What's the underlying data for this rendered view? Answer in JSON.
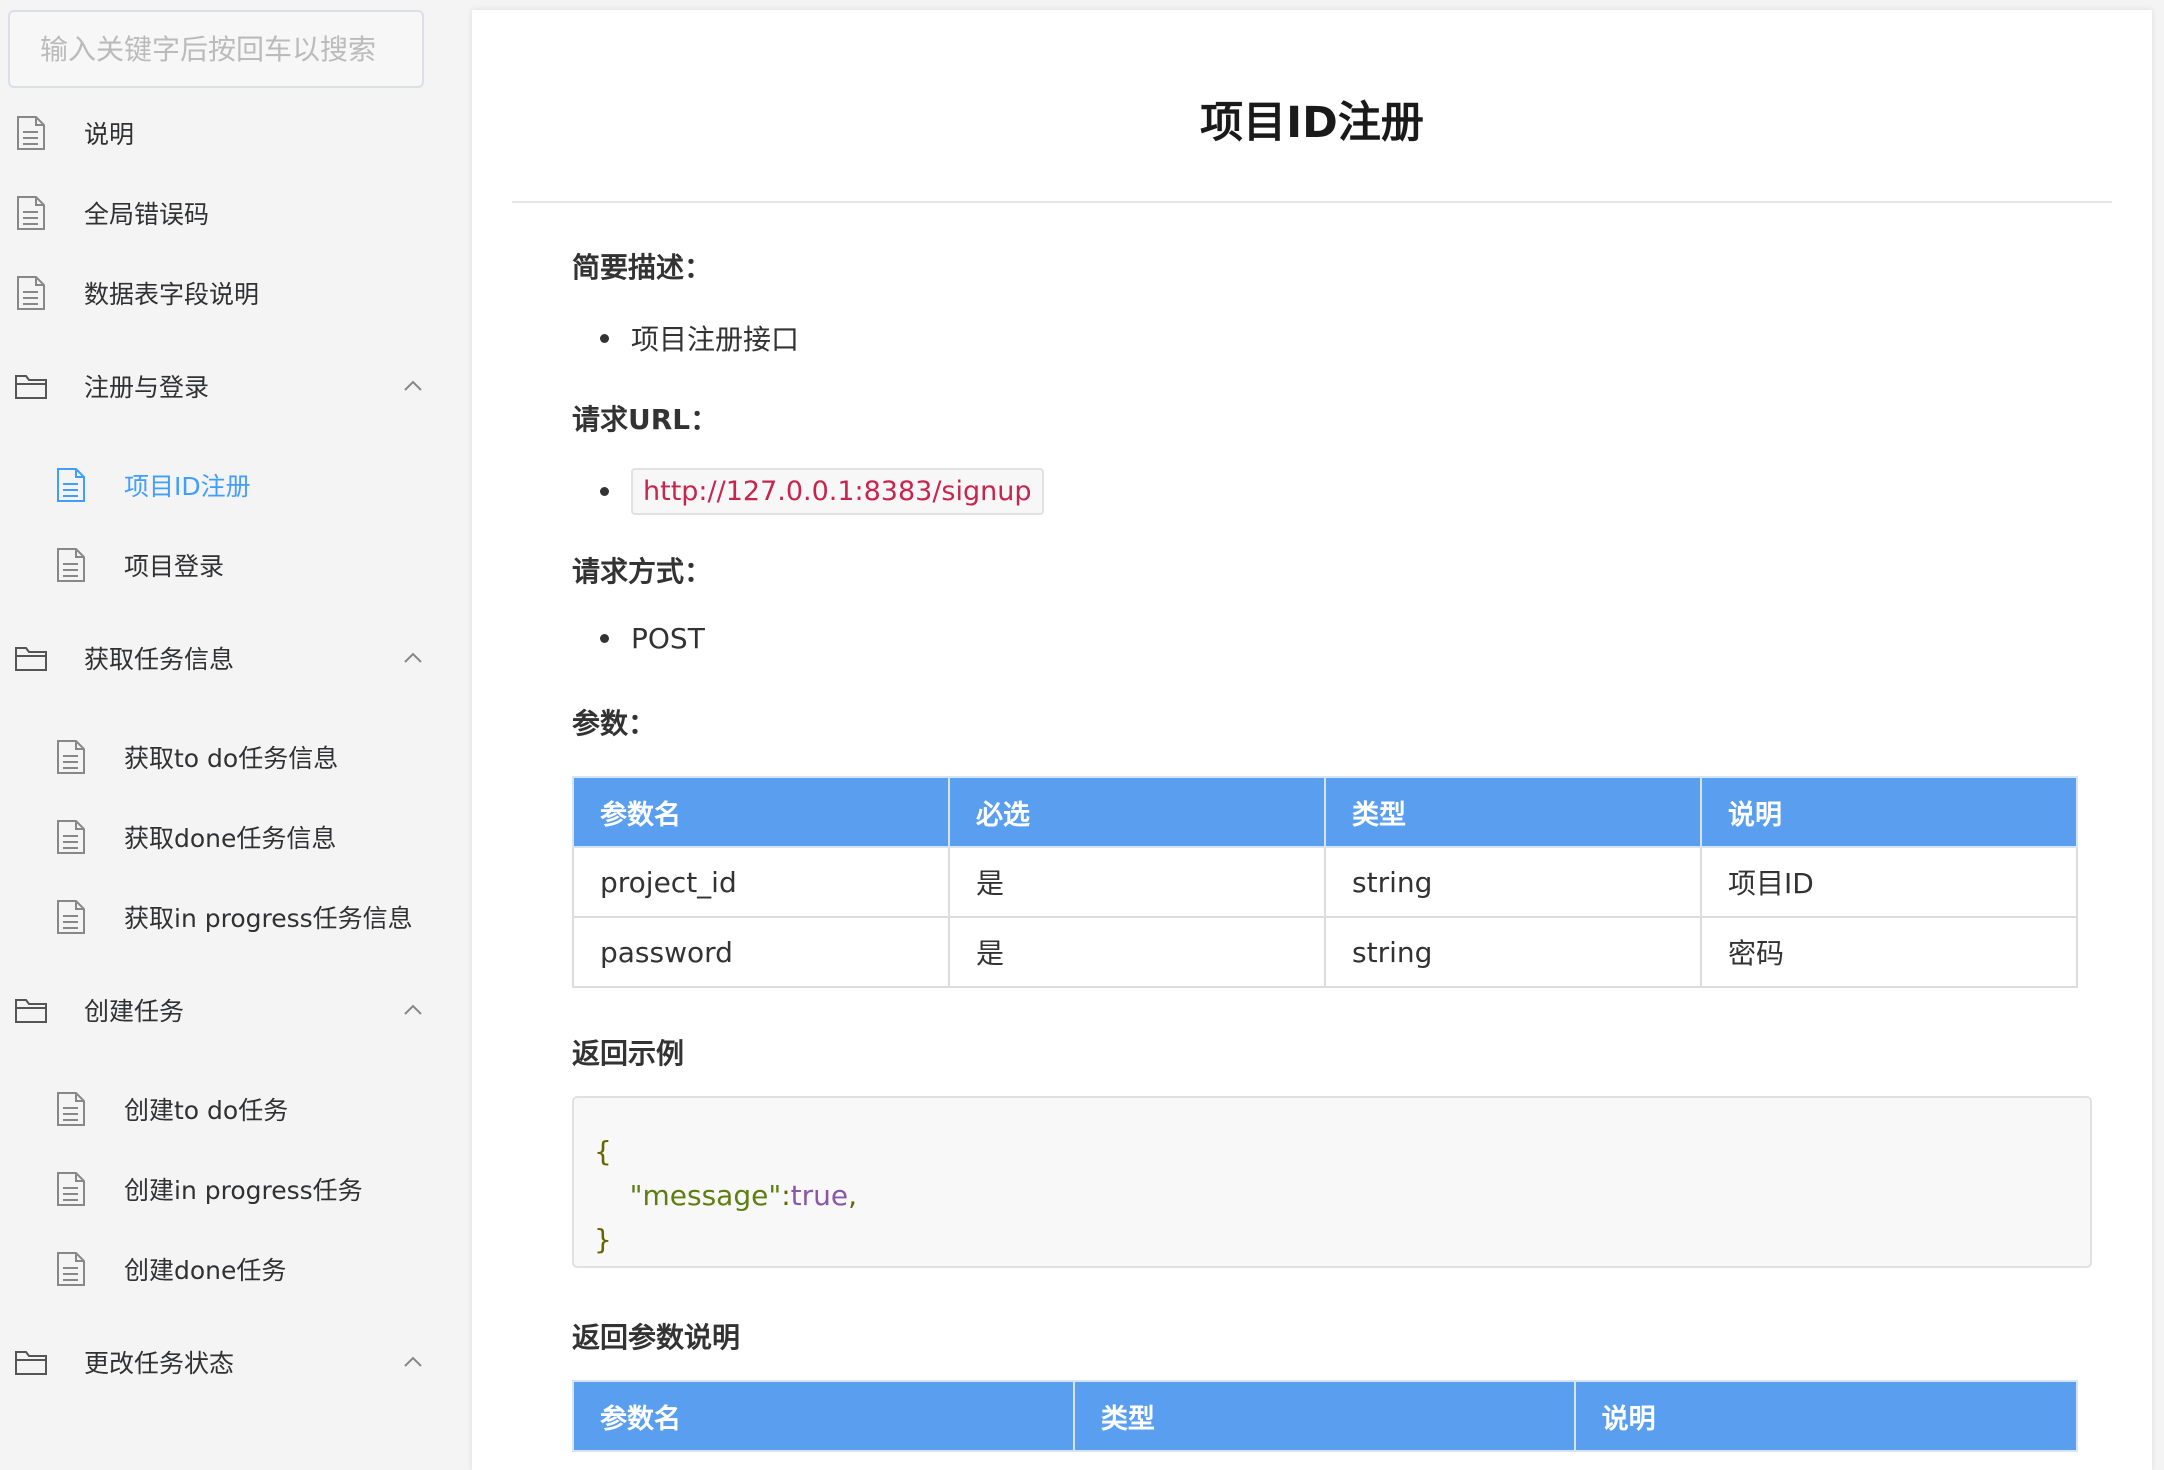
{
  "sidebar": {
    "search_placeholder": "输入关键字后按回车以搜索",
    "items": [
      {
        "label": "说明"
      },
      {
        "label": "全局错误码"
      },
      {
        "label": "数据表字段说明"
      },
      {
        "label": "注册与登录"
      },
      {
        "label": "项目ID注册"
      },
      {
        "label": "项目登录"
      },
      {
        "label": "获取任务信息"
      },
      {
        "label": "获取to do任务信息"
      },
      {
        "label": "获取done任务信息"
      },
      {
        "label": "获取in progress任务信息"
      },
      {
        "label": "创建任务"
      },
      {
        "label": "创建to do任务"
      },
      {
        "label": "创建in progress任务"
      },
      {
        "label": "创建done任务"
      },
      {
        "label": "更改任务状态"
      }
    ]
  },
  "doc": {
    "title": "项目ID注册",
    "summary_heading": "简要描述：",
    "summary_item": "项目注册接口",
    "url_heading": "请求URL：",
    "url": "http://127.0.0.1:8383/signup",
    "method_heading": "请求方式：",
    "method": "POST",
    "params_heading": "参数：",
    "params_table": {
      "headers": [
        "参数名",
        "必选",
        "类型",
        "说明"
      ],
      "rows": [
        [
          "project_id",
          "是",
          "string",
          "项目ID"
        ],
        [
          "password",
          "是",
          "string",
          "密码"
        ]
      ]
    },
    "example_heading": "返回示例",
    "code": {
      "open": "{",
      "key": "\"message\"",
      "colon": ":",
      "value": "true",
      "comma": ",",
      "close": "}"
    },
    "return_heading": "返回参数说明",
    "return_table": {
      "headers": [
        "参数名",
        "类型",
        "说明"
      ]
    }
  },
  "colors": {
    "accent": "#409eff",
    "table_header": "#5a9ef0",
    "url_text": "#c7254e"
  }
}
